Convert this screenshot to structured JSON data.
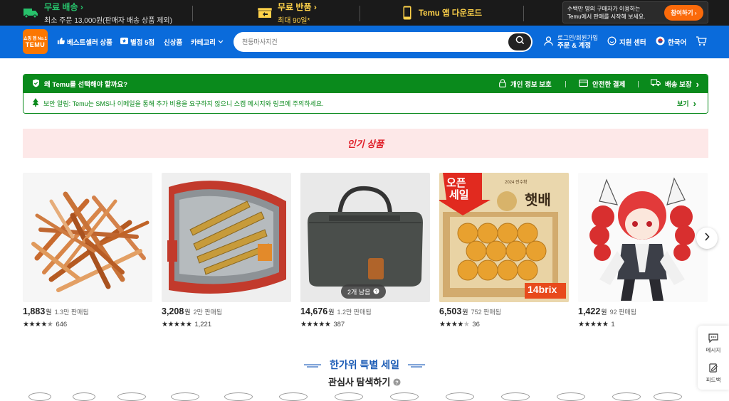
{
  "topbar": {
    "free_shipping_title": "무료 배송",
    "free_shipping_sub": "최소 주문 13,000원(판매자 배송 상품 제외)",
    "free_return_title": "무료 반품",
    "free_return_sub": "최대 90일*",
    "app_title": "Temu 앱 다운로드",
    "promo_line1": "수백만 명의 구매자가 이용하는",
    "promo_line2": "Temu에서 판매를 시작해 보세요.",
    "promo_button": "참여하기"
  },
  "nav": {
    "logo_top": "쇼핑 앱 No.1",
    "logo_bottom": "TEMU",
    "bestseller": "베스트셀러 상품",
    "five_star": "별점 5점",
    "new_arrivals": "신상품",
    "categories": "카테고리",
    "search_placeholder": "천둥마사지건",
    "login_line1": "로그인/회원가입",
    "login_line2": "주문 & 계정",
    "support": "지원 센터",
    "language": "한국어"
  },
  "banner": {
    "why_temu": "왜 Temu를 선택해야 할까요?",
    "privacy": "개인 정보 보호",
    "secure_payment": "안전한 결제",
    "delivery_guarantee": "배송 보장",
    "security_notice": "보안 알림: Temu는 SMS나 이메일을 통해 추가 비용을 요구하지 않으니 스캠 메시지와 링크에 주의하세요.",
    "view": "보기"
  },
  "hot_section": {
    "title": "인기 상품"
  },
  "products": [
    {
      "price": "1,883",
      "currency": "원",
      "sold": "1.3만 판매됨",
      "rating": 4.5,
      "reviews": "646"
    },
    {
      "price": "3,208",
      "currency": "원",
      "sold": "2만 판매됨",
      "rating": 5,
      "reviews": "1,221"
    },
    {
      "price": "14,676",
      "currency": "원",
      "sold": "1.2만 판매됨",
      "rating": 5,
      "reviews": "387",
      "badge": "2개 남음"
    },
    {
      "price": "6,503",
      "currency": "원",
      "sold": "752 판매됨",
      "rating": 4,
      "reviews": "36",
      "img_text_1": "오픈",
      "img_text_2": "세일",
      "img_text_3": "햇배",
      "img_text_4": "14brix",
      "img_text_5": "2024 전수확"
    },
    {
      "price": "1,422",
      "currency": "원",
      "sold": "92 판매됨",
      "rating": 5,
      "reviews": "1"
    }
  ],
  "festival": {
    "title": "한가위 특별 세일",
    "subtitle": "관심사 탐색하기"
  },
  "side": {
    "message": "메시지",
    "feedback": "피드백"
  },
  "colors": {
    "nav_blue": "#0a6bdb",
    "temu_orange": "#fb7701",
    "banner_green": "#0a8a1c",
    "hot_red": "#e0202a"
  }
}
